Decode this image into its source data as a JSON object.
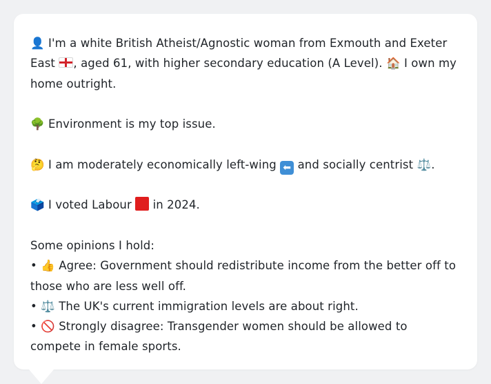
{
  "profile": {
    "intro_icon": "👤",
    "intro_a": "I'm a white British Atheist/Agnostic woman from Exmouth and Exeter East",
    "flag_icon": "england-flag-icon",
    "intro_b": ", aged 61, with higher secondary education (A Level).",
    "home_icon": "🏠",
    "intro_c": "I own my home outright.",
    "issue_icon": "🌳",
    "issue_text": "Environment is my top issue.",
    "thinking_icon": "🤔",
    "politics_a": "I am moderately economically left-wing",
    "left_arrow_icon": "⬅",
    "politics_b": "and socially centrist",
    "scales_icon": "⚖️",
    "politics_c": ".",
    "ballot_icon": "🗳️",
    "vote_a": "I voted Labour",
    "vote_b": "in 2024.",
    "opinions_heading": "Some opinions I hold:",
    "opinions": [
      {
        "bullet": "•",
        "icon": "👍",
        "text": "Agree: Government should redistribute income from the better off to those who are less well off."
      },
      {
        "bullet": "•",
        "icon": "⚖️",
        "text": "The UK's current immigration levels are about right."
      },
      {
        "bullet": "•",
        "icon": "🚫",
        "text": "Strongly disagree: Transgender women should be allowed to compete in female sports."
      }
    ]
  },
  "colors": {
    "page_bg": "#f0f1f3",
    "card_bg": "#ffffff",
    "text": "#1f2328",
    "labour_red": "#e01e1e"
  }
}
